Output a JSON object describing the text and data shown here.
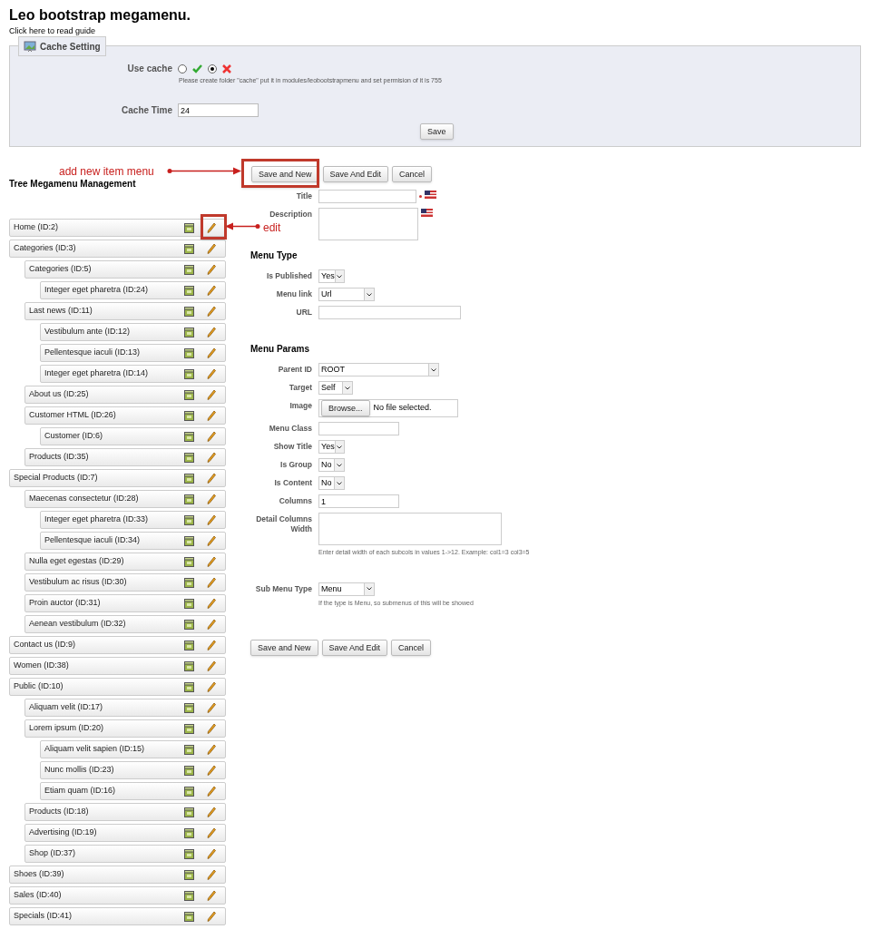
{
  "page_title": "Leo bootstrap megamenu.",
  "guide_link": "Click here to read guide",
  "cache_setting": {
    "legend": "Cache Setting",
    "use_cache_label": "Use cache",
    "options": [
      {
        "kind": "yes",
        "selected": false
      },
      {
        "kind": "no",
        "selected": true
      }
    ],
    "note": "Please create folder \"cache\" put it in modules/leobootstrapmenu and set permision of it is 755",
    "cache_time_label": "Cache Time",
    "cache_time_value": "24",
    "save_button": "Save"
  },
  "tree_title": "Tree Megamenu Management",
  "tree": [
    {
      "label": "Home (ID:2)"
    },
    {
      "label": "Categories (ID:3)",
      "children": [
        {
          "label": "Categories (ID:5)",
          "children": [
            {
              "label": "Integer eget pharetra (ID:24)"
            }
          ]
        },
        {
          "label": "Last news (ID:11)",
          "children": [
            {
              "label": "Vestibulum ante (ID:12)"
            },
            {
              "label": "Pellentesque iaculi (ID:13)"
            },
            {
              "label": "Integer eget pharetra (ID:14)"
            }
          ]
        },
        {
          "label": "About us (ID:25)"
        },
        {
          "label": "Customer HTML (ID:26)",
          "children": [
            {
              "label": "Customer (ID:6)"
            }
          ]
        },
        {
          "label": "Products (ID:35)"
        }
      ]
    },
    {
      "label": "Special Products (ID:7)",
      "children": [
        {
          "label": "Maecenas consectetur (ID:28)",
          "children": [
            {
              "label": "Integer eget pharetra (ID:33)"
            },
            {
              "label": "Pellentesque iaculi (ID:34)"
            }
          ]
        },
        {
          "label": "Nulla eget egestas (ID:29)"
        },
        {
          "label": "Vestibulum ac risus (ID:30)"
        },
        {
          "label": "Proin auctor (ID:31)"
        },
        {
          "label": "Aenean vestibulum (ID:32)"
        }
      ]
    },
    {
      "label": "Contact us (ID:9)"
    },
    {
      "label": "Women (ID:38)"
    },
    {
      "label": "Public (ID:10)",
      "children": [
        {
          "label": "Aliquam velit (ID:17)"
        },
        {
          "label": "Lorem ipsum (ID:20)",
          "children": [
            {
              "label": "Aliquam velit sapien (ID:15)"
            },
            {
              "label": "Nunc mollis (ID:23)"
            },
            {
              "label": "Etiam quam (ID:16)"
            }
          ]
        },
        {
          "label": "Products (ID:18)"
        },
        {
          "label": "Advertising (ID:19)"
        },
        {
          "label": "Shop (ID:37)"
        }
      ]
    },
    {
      "label": "Shoes (ID:39)"
    },
    {
      "label": "Sales (ID:40)"
    },
    {
      "label": "Specials (ID:41)"
    }
  ],
  "top_buttons": [
    "Save and New",
    "Save And Edit",
    "Cancel"
  ],
  "form": [
    {
      "kind": "text",
      "label": "Title",
      "required": true,
      "flag": true
    },
    {
      "kind": "textarea",
      "label": "Description",
      "flag": true
    },
    {
      "kind": "heading",
      "label": "Menu Type"
    },
    {
      "kind": "select",
      "label": "Is Published",
      "value": "Yes"
    },
    {
      "kind": "select",
      "label": "Menu link",
      "value": "Url"
    },
    {
      "kind": "text",
      "label": "URL"
    },
    {
      "kind": "heading",
      "label": "Menu Params"
    },
    {
      "kind": "select",
      "label": "Parent ID",
      "value": "ROOT"
    },
    {
      "kind": "select",
      "label": "Target",
      "value": "Self"
    },
    {
      "kind": "file",
      "label": "Image",
      "button": "Browse...",
      "value": "No file selected."
    },
    {
      "kind": "text",
      "label": "Menu Class"
    },
    {
      "kind": "select",
      "label": "Show Title",
      "value": "Yes"
    },
    {
      "kind": "select",
      "label": "Is Group",
      "value": "No"
    },
    {
      "kind": "select",
      "label": "Is Content",
      "value": "No"
    },
    {
      "kind": "text",
      "label": "Columns",
      "value": "1"
    },
    {
      "kind": "textarea",
      "label": "Detail Columns Width",
      "help": "Enter detail width of each subcols in values 1->12. Example: col1=3 col3=5"
    },
    {
      "kind": "select",
      "label": "Sub Menu Type",
      "value": "Menu",
      "help": "If the type is Menu, so submenus of this will be showed"
    }
  ],
  "bottom_buttons": [
    "Save and New",
    "Save And Edit",
    "Cancel"
  ],
  "annotations": [
    {
      "kind": "add",
      "text": "add new item menu"
    },
    {
      "kind": "edit",
      "text": "edit"
    }
  ]
}
